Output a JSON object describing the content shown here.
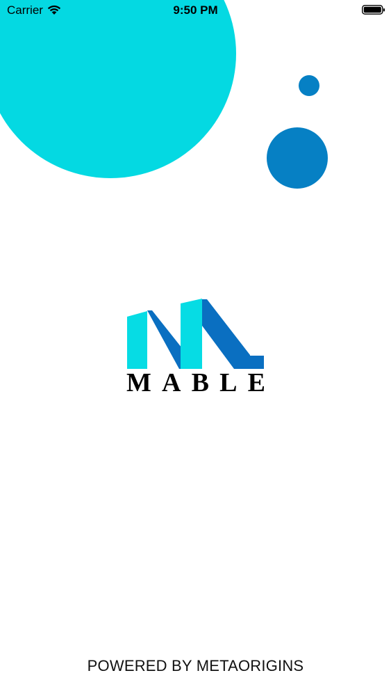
{
  "status_bar": {
    "carrier": "Carrier",
    "time": "9:50 PM",
    "wifi_icon": "wifi-icon",
    "battery_icon": "battery-icon"
  },
  "colors": {
    "cyan": "#04d9e2",
    "blue": "#0680c4",
    "logo_cyan": "#06dce4",
    "logo_blue": "#0a6fc1",
    "text": "#000000"
  },
  "brand": {
    "letters": [
      "M",
      "A",
      "B",
      "L",
      "E"
    ]
  },
  "footer": {
    "powered_by": "POWERED BY METAORIGINS"
  }
}
